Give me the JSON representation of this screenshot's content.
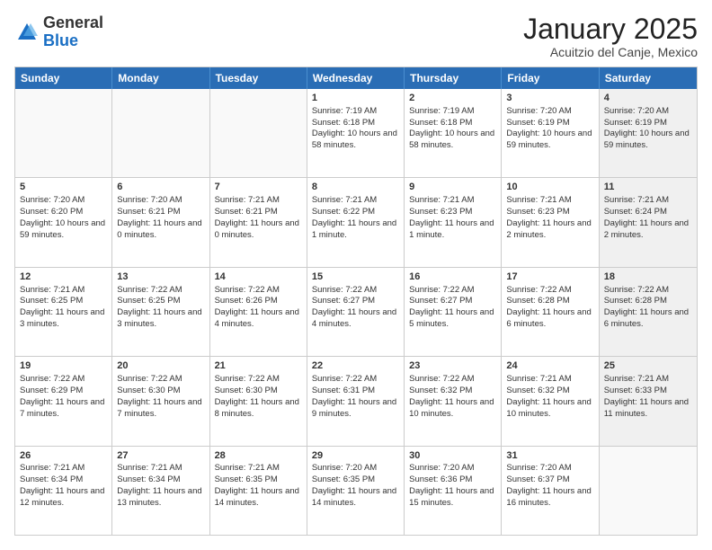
{
  "header": {
    "logo_general": "General",
    "logo_blue": "Blue",
    "month_title": "January 2025",
    "location": "Acuitzio del Canje, Mexico"
  },
  "weekdays": [
    "Sunday",
    "Monday",
    "Tuesday",
    "Wednesday",
    "Thursday",
    "Friday",
    "Saturday"
  ],
  "rows": [
    [
      {
        "day": "",
        "info": "",
        "shaded": true
      },
      {
        "day": "",
        "info": "",
        "shaded": true
      },
      {
        "day": "",
        "info": "",
        "shaded": true
      },
      {
        "day": "1",
        "info": "Sunrise: 7:19 AM\nSunset: 6:18 PM\nDaylight: 10 hours and 58 minutes.",
        "shaded": false
      },
      {
        "day": "2",
        "info": "Sunrise: 7:19 AM\nSunset: 6:18 PM\nDaylight: 10 hours and 58 minutes.",
        "shaded": false
      },
      {
        "day": "3",
        "info": "Sunrise: 7:20 AM\nSunset: 6:19 PM\nDaylight: 10 hours and 59 minutes.",
        "shaded": false
      },
      {
        "day": "4",
        "info": "Sunrise: 7:20 AM\nSunset: 6:19 PM\nDaylight: 10 hours and 59 minutes.",
        "shaded": true
      }
    ],
    [
      {
        "day": "5",
        "info": "Sunrise: 7:20 AM\nSunset: 6:20 PM\nDaylight: 10 hours and 59 minutes.",
        "shaded": false
      },
      {
        "day": "6",
        "info": "Sunrise: 7:20 AM\nSunset: 6:21 PM\nDaylight: 11 hours and 0 minutes.",
        "shaded": false
      },
      {
        "day": "7",
        "info": "Sunrise: 7:21 AM\nSunset: 6:21 PM\nDaylight: 11 hours and 0 minutes.",
        "shaded": false
      },
      {
        "day": "8",
        "info": "Sunrise: 7:21 AM\nSunset: 6:22 PM\nDaylight: 11 hours and 1 minute.",
        "shaded": false
      },
      {
        "day": "9",
        "info": "Sunrise: 7:21 AM\nSunset: 6:23 PM\nDaylight: 11 hours and 1 minute.",
        "shaded": false
      },
      {
        "day": "10",
        "info": "Sunrise: 7:21 AM\nSunset: 6:23 PM\nDaylight: 11 hours and 2 minutes.",
        "shaded": false
      },
      {
        "day": "11",
        "info": "Sunrise: 7:21 AM\nSunset: 6:24 PM\nDaylight: 11 hours and 2 minutes.",
        "shaded": true
      }
    ],
    [
      {
        "day": "12",
        "info": "Sunrise: 7:21 AM\nSunset: 6:25 PM\nDaylight: 11 hours and 3 minutes.",
        "shaded": false
      },
      {
        "day": "13",
        "info": "Sunrise: 7:22 AM\nSunset: 6:25 PM\nDaylight: 11 hours and 3 minutes.",
        "shaded": false
      },
      {
        "day": "14",
        "info": "Sunrise: 7:22 AM\nSunset: 6:26 PM\nDaylight: 11 hours and 4 minutes.",
        "shaded": false
      },
      {
        "day": "15",
        "info": "Sunrise: 7:22 AM\nSunset: 6:27 PM\nDaylight: 11 hours and 4 minutes.",
        "shaded": false
      },
      {
        "day": "16",
        "info": "Sunrise: 7:22 AM\nSunset: 6:27 PM\nDaylight: 11 hours and 5 minutes.",
        "shaded": false
      },
      {
        "day": "17",
        "info": "Sunrise: 7:22 AM\nSunset: 6:28 PM\nDaylight: 11 hours and 6 minutes.",
        "shaded": false
      },
      {
        "day": "18",
        "info": "Sunrise: 7:22 AM\nSunset: 6:28 PM\nDaylight: 11 hours and 6 minutes.",
        "shaded": true
      }
    ],
    [
      {
        "day": "19",
        "info": "Sunrise: 7:22 AM\nSunset: 6:29 PM\nDaylight: 11 hours and 7 minutes.",
        "shaded": false
      },
      {
        "day": "20",
        "info": "Sunrise: 7:22 AM\nSunset: 6:30 PM\nDaylight: 11 hours and 7 minutes.",
        "shaded": false
      },
      {
        "day": "21",
        "info": "Sunrise: 7:22 AM\nSunset: 6:30 PM\nDaylight: 11 hours and 8 minutes.",
        "shaded": false
      },
      {
        "day": "22",
        "info": "Sunrise: 7:22 AM\nSunset: 6:31 PM\nDaylight: 11 hours and 9 minutes.",
        "shaded": false
      },
      {
        "day": "23",
        "info": "Sunrise: 7:22 AM\nSunset: 6:32 PM\nDaylight: 11 hours and 10 minutes.",
        "shaded": false
      },
      {
        "day": "24",
        "info": "Sunrise: 7:21 AM\nSunset: 6:32 PM\nDaylight: 11 hours and 10 minutes.",
        "shaded": false
      },
      {
        "day": "25",
        "info": "Sunrise: 7:21 AM\nSunset: 6:33 PM\nDaylight: 11 hours and 11 minutes.",
        "shaded": true
      }
    ],
    [
      {
        "day": "26",
        "info": "Sunrise: 7:21 AM\nSunset: 6:34 PM\nDaylight: 11 hours and 12 minutes.",
        "shaded": false
      },
      {
        "day": "27",
        "info": "Sunrise: 7:21 AM\nSunset: 6:34 PM\nDaylight: 11 hours and 13 minutes.",
        "shaded": false
      },
      {
        "day": "28",
        "info": "Sunrise: 7:21 AM\nSunset: 6:35 PM\nDaylight: 11 hours and 14 minutes.",
        "shaded": false
      },
      {
        "day": "29",
        "info": "Sunrise: 7:20 AM\nSunset: 6:35 PM\nDaylight: 11 hours and 14 minutes.",
        "shaded": false
      },
      {
        "day": "30",
        "info": "Sunrise: 7:20 AM\nSunset: 6:36 PM\nDaylight: 11 hours and 15 minutes.",
        "shaded": false
      },
      {
        "day": "31",
        "info": "Sunrise: 7:20 AM\nSunset: 6:37 PM\nDaylight: 11 hours and 16 minutes.",
        "shaded": false
      },
      {
        "day": "",
        "info": "",
        "shaded": true
      }
    ]
  ]
}
